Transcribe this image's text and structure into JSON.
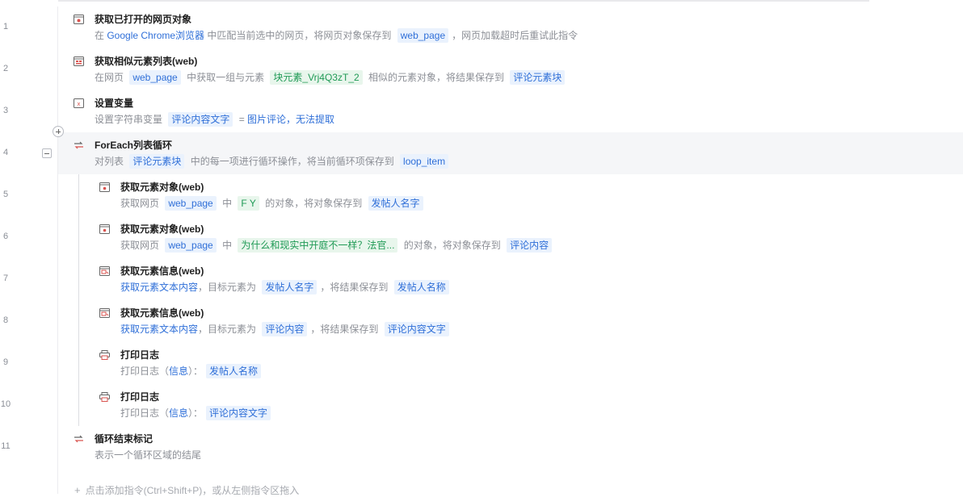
{
  "steps": [
    {
      "num": "1",
      "title": "获取已打开的网页对象",
      "icon": "browser-window-icon",
      "desc": [
        {
          "t": "在 "
        },
        {
          "blue": "Google Chrome浏览器"
        },
        {
          "t": " 中匹配当前选中的网页，将网页对象保存到 "
        },
        {
          "var": "web_page"
        },
        {
          "t": "，网页加载超时后重试此指令"
        }
      ]
    },
    {
      "num": "2",
      "title": "获取相似元素列表(web)",
      "icon": "element-list-icon",
      "desc": [
        {
          "t": "在网页 "
        },
        {
          "var": "web_page"
        },
        {
          "t": " 中获取一组与元素 "
        },
        {
          "el": "块元素_Vrj4Q3zT_2"
        },
        {
          "t": " 相似的元素对象，将结果保存到 "
        },
        {
          "var": "评论元素块"
        }
      ]
    },
    {
      "num": "3",
      "title": "设置变量",
      "icon": "variable-icon",
      "desc": [
        {
          "t": "设置字符串变量 "
        },
        {
          "var": "评论内容文字"
        },
        {
          "t": " = "
        },
        {
          "blue": "图片评论，无法提取"
        }
      ]
    },
    {
      "num": "4",
      "title": "ForEach列表循环",
      "icon": "loop-icon",
      "desc": [
        {
          "t": "对列表 "
        },
        {
          "var": "评论元素块"
        },
        {
          "t": " 中的每一项进行循环操作，将当前循环项保存到 "
        },
        {
          "var": "loop_item"
        }
      ]
    },
    {
      "num": "5",
      "title": "获取元素对象(web)",
      "icon": "web-element-icon",
      "desc": [
        {
          "t": "获取网页 "
        },
        {
          "var": "web_page"
        },
        {
          "t": " 中 "
        },
        {
          "el": "F Y"
        },
        {
          "t": " 的对象，将对象保存到 "
        },
        {
          "var": "发帖人名字"
        }
      ]
    },
    {
      "num": "6",
      "title": "获取元素对象(web)",
      "icon": "web-element-icon",
      "desc": [
        {
          "t": "获取网页 "
        },
        {
          "var": "web_page"
        },
        {
          "t": " 中 "
        },
        {
          "el": "为什么和现实中开庭不一样？法官..."
        },
        {
          "t": " 的对象，将对象保存到 "
        },
        {
          "var": "评论内容"
        }
      ]
    },
    {
      "num": "7",
      "title": "获取元素信息(web)",
      "icon": "element-info-icon",
      "desc": [
        {
          "blue": "获取元素文本内容"
        },
        {
          "t": "，目标元素为 "
        },
        {
          "var": "发帖人名字"
        },
        {
          "t": "，将结果保存到 "
        },
        {
          "var": "发帖人名称"
        }
      ]
    },
    {
      "num": "8",
      "title": "获取元素信息(web)",
      "icon": "element-info-icon",
      "desc": [
        {
          "blue": "获取元素文本内容"
        },
        {
          "t": "，目标元素为 "
        },
        {
          "var": "评论内容"
        },
        {
          "t": "，将结果保存到 "
        },
        {
          "var": "评论内容文字"
        }
      ]
    },
    {
      "num": "9",
      "title": "打印日志",
      "icon": "print-log-icon",
      "desc": [
        {
          "t": "打印日志（"
        },
        {
          "blue": "信息"
        },
        {
          "t": "）："
        },
        {
          "var": "发帖人名称"
        }
      ]
    },
    {
      "num": "10",
      "title": "打印日志",
      "icon": "print-log-icon",
      "desc": [
        {
          "t": "打印日志（"
        },
        {
          "blue": "信息"
        },
        {
          "t": "）："
        },
        {
          "var": "评论内容文字"
        }
      ]
    },
    {
      "num": "11",
      "title": "循环结束标记",
      "icon": "loop-end-icon",
      "desc": [
        {
          "t": "表示一个循环区域的结尾"
        }
      ]
    }
  ],
  "add_hint": "点击添加指令(Ctrl+Shift+P)，或从左侧指令区拖入",
  "colors": {
    "accent": "#2f6fd8",
    "element_green": "#1f9a55",
    "row_highlight": "#f5f6f8",
    "icon_red": "#d9534f"
  }
}
